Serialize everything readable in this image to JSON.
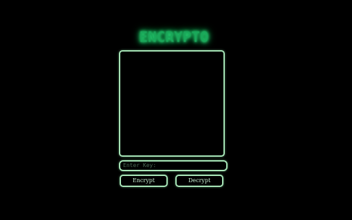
{
  "app": {
    "title": "ENCRYPTO"
  },
  "message_area": {
    "value": ""
  },
  "key_input": {
    "placeholder": "Enter Key:",
    "value": ""
  },
  "actions": {
    "encrypt_label": "Encrypt",
    "decrypt_label": "Decrypt"
  },
  "colors": {
    "background": "#000000",
    "accent": "#1aa85a",
    "border": "#a8e6b8"
  }
}
